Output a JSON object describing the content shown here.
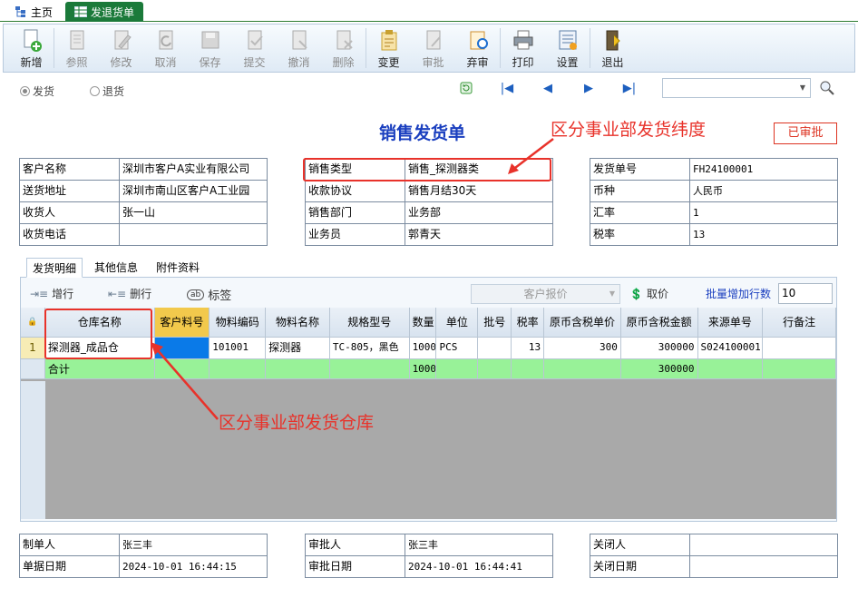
{
  "tabs": {
    "home": "主页",
    "active": "发退货单"
  },
  "toolbar": [
    {
      "id": "new",
      "label": "新增",
      "enabled": true
    },
    {
      "id": "ref",
      "label": "参照",
      "enabled": false
    },
    {
      "id": "edit",
      "label": "修改",
      "enabled": false
    },
    {
      "id": "cancel",
      "label": "取消",
      "enabled": false
    },
    {
      "id": "save",
      "label": "保存",
      "enabled": false
    },
    {
      "id": "submit",
      "label": "提交",
      "enabled": false
    },
    {
      "id": "revoke",
      "label": "撤消",
      "enabled": false
    },
    {
      "id": "delete",
      "label": "删除",
      "enabled": false
    },
    {
      "id": "change",
      "label": "变更",
      "enabled": true
    },
    {
      "id": "approve",
      "label": "审批",
      "enabled": false
    },
    {
      "id": "abandon",
      "label": "弃审",
      "enabled": true
    },
    {
      "id": "print",
      "label": "打印",
      "enabled": true
    },
    {
      "id": "settings",
      "label": "设置",
      "enabled": true
    },
    {
      "id": "exit",
      "label": "退出",
      "enabled": true
    }
  ],
  "mode": {
    "ship": "发货",
    "return": "退货"
  },
  "title": "销售发货单",
  "status_stamp": "已审批",
  "annotations": {
    "top": "区分事业部发货纬度",
    "bottom": "区分事业部发货仓库"
  },
  "colors": {
    "annotation": "#e8322a",
    "title": "#1a3fbf",
    "sum_row": "#98f298",
    "tab_active": "#1b7a3a"
  },
  "header_left": [
    {
      "label": "客户名称",
      "value": "深圳市客户A实业有限公司"
    },
    {
      "label": "送货地址",
      "value": "深圳市南山区客户A工业园"
    },
    {
      "label": "收货人",
      "value": "张一山"
    },
    {
      "label": "收货电话",
      "value": ""
    }
  ],
  "header_mid": [
    {
      "label": "销售类型",
      "value": "销售_探测器类"
    },
    {
      "label": "收款协议",
      "value": "销售月结30天"
    },
    {
      "label": "销售部门",
      "value": "业务部"
    },
    {
      "label": "业务员",
      "value": "郭青天"
    }
  ],
  "header_right": [
    {
      "label": "发货单号",
      "value": "FH24100001"
    },
    {
      "label": "币种",
      "value": "人民币"
    },
    {
      "label": "汇率",
      "value": "1"
    },
    {
      "label": "税率",
      "value": "13"
    }
  ],
  "detail_tabs": [
    "发货明细",
    "其他信息",
    "附件资料"
  ],
  "detail_toolbar": {
    "add_row": "增行",
    "del_row": "删行",
    "tag": "标签",
    "cust_quote": "客户报价",
    "get_price": "取价",
    "batch_label": "批量增加行数",
    "batch_value": "10"
  },
  "grid": {
    "columns": [
      "仓库名称",
      "客户料号",
      "物料编码",
      "物料名称",
      "规格型号",
      "数量",
      "单位",
      "批号",
      "税率",
      "原币含税单价",
      "原币含税金额",
      "来源单号",
      "行备注"
    ],
    "rows": [
      {
        "no": "1",
        "warehouse": "探测器_成品仓",
        "cust_code": "",
        "item_code": "101001",
        "item_name": "探测器",
        "spec": "TC-805，黑色",
        "qty": "1000",
        "unit": "PCS",
        "batch": "",
        "tax": "13",
        "price": "300",
        "amount": "300000",
        "source": "S024100001",
        "remark": ""
      }
    ],
    "sum": {
      "label": "合计",
      "qty": "1000",
      "amount": "300000"
    }
  },
  "footer_left": [
    {
      "label": "制单人",
      "value": "张三丰"
    },
    {
      "label": "单据日期",
      "value": "2024-10-01 16:44:15"
    }
  ],
  "footer_mid": [
    {
      "label": "审批人",
      "value": "张三丰"
    },
    {
      "label": "审批日期",
      "value": "2024-10-01 16:44:41"
    }
  ],
  "footer_right": [
    {
      "label": "关闭人",
      "value": ""
    },
    {
      "label": "关闭日期",
      "value": ""
    }
  ]
}
